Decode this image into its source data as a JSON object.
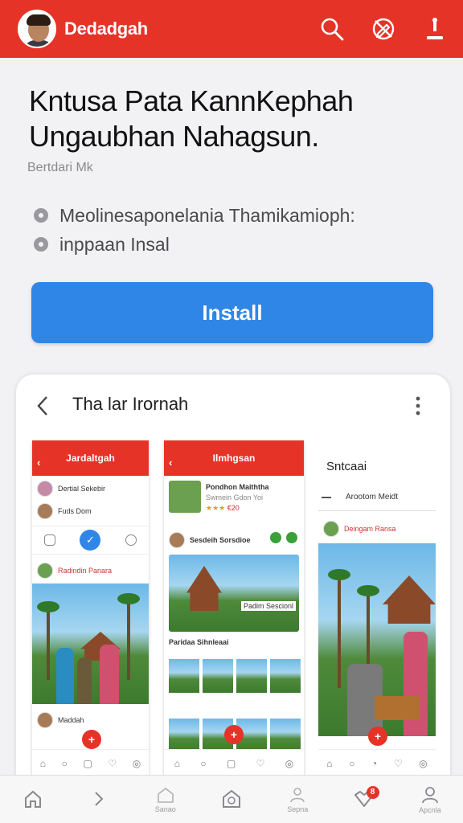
{
  "header": {
    "app_name": "Dedadgah",
    "icons": [
      "search-icon",
      "no-edit-icon",
      "download-icon"
    ]
  },
  "hero": {
    "title": "Kntusa Pata KannKephah Ungaubhan Nahagsun.",
    "subtitle": "Bertdari Mk",
    "bullets": [
      "Meolinesaponelania Thamikamioph:",
      "inppaan Insal"
    ],
    "install_label": "Install"
  },
  "preview": {
    "title": "Tha lar Irornah",
    "phone1": {
      "header": "Jardaltgah",
      "rows": [
        "Dertial Sekebir",
        "Fuds Dom"
      ],
      "post_title": "Radindin Panara",
      "post_footer": "Maddah"
    },
    "phone2": {
      "header": "Ilmhgsan",
      "feature_title": "Pondhon Maiththa",
      "feature_sub": "Swmein Gdon Yoi",
      "feature_rating": "★★★",
      "feature_value": "€20",
      "author": "Sesdeih Sorsdioe",
      "caption": "Padim Sescionl",
      "grid_title": "Paridaa Sihnleaai"
    },
    "phone3": {
      "section_title": "Sntcaai",
      "tab_label": "Arootom Meidt",
      "post_title": "Deingam Ransa"
    }
  },
  "bottom_nav": {
    "items": [
      {
        "icon": "home-icon",
        "label": ""
      },
      {
        "icon": "chevron-icon",
        "label": ""
      },
      {
        "icon": "house-outline-icon",
        "label": "Sanao"
      },
      {
        "icon": "house-plus-icon",
        "label": ""
      },
      {
        "icon": "user-icon",
        "label": "Sepna"
      },
      {
        "icon": "heart-icon",
        "label": ""
      },
      {
        "icon": "profile-icon",
        "label": "Apcnla"
      }
    ],
    "badge": "8"
  },
  "colors": {
    "brand": "#e53328",
    "install": "#2f86e6"
  }
}
